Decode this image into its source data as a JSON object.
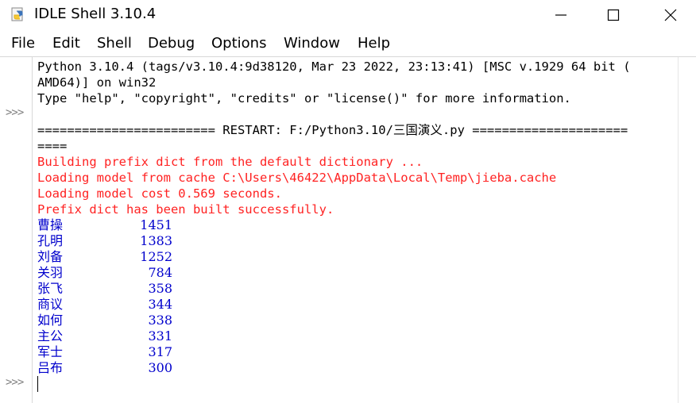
{
  "window": {
    "title": "IDLE Shell 3.10.4"
  },
  "menu": [
    "File",
    "Edit",
    "Shell",
    "Debug",
    "Options",
    "Window",
    "Help"
  ],
  "prompts": [
    ">>>",
    ">>>"
  ],
  "banner": [
    "Python 3.10.4 (tags/v3.10.4:9d38120, Mar 23 2022, 23:13:41) [MSC v.1929 64 bit (",
    "AMD64)] on win32",
    "Type \"help\", \"copyright\", \"credits\" or \"license()\" for more information."
  ],
  "restart": [
    "======================== RESTART: F:/Python3.10/三国演义.py =====================",
    "===="
  ],
  "stderr": [
    "Building prefix dict from the default dictionary ...",
    "Loading model from cache C:\\Users\\46422\\AppData\\Local\\Temp\\jieba.cache",
    "Loading model cost 0.569 seconds.",
    "Prefix dict has been built successfully."
  ],
  "results": [
    {
      "word": "曹操",
      "count": "1451"
    },
    {
      "word": "孔明",
      "count": "1383"
    },
    {
      "word": "刘备",
      "count": "1252"
    },
    {
      "word": "关羽",
      "count": "784"
    },
    {
      "word": "张飞",
      "count": "358"
    },
    {
      "word": "商议",
      "count": "344"
    },
    {
      "word": "如何",
      "count": "338"
    },
    {
      "word": "主公",
      "count": "331"
    },
    {
      "word": "军士",
      "count": "317"
    },
    {
      "word": "吕布",
      "count": "300"
    }
  ],
  "colors": {
    "stdout": "#0000cc",
    "stderr": "#ff2222",
    "prompt": "#808080"
  },
  "icons": {
    "app": "python-idle-icon",
    "minimize": "minimize-icon",
    "maximize": "maximize-icon",
    "close": "close-icon"
  }
}
